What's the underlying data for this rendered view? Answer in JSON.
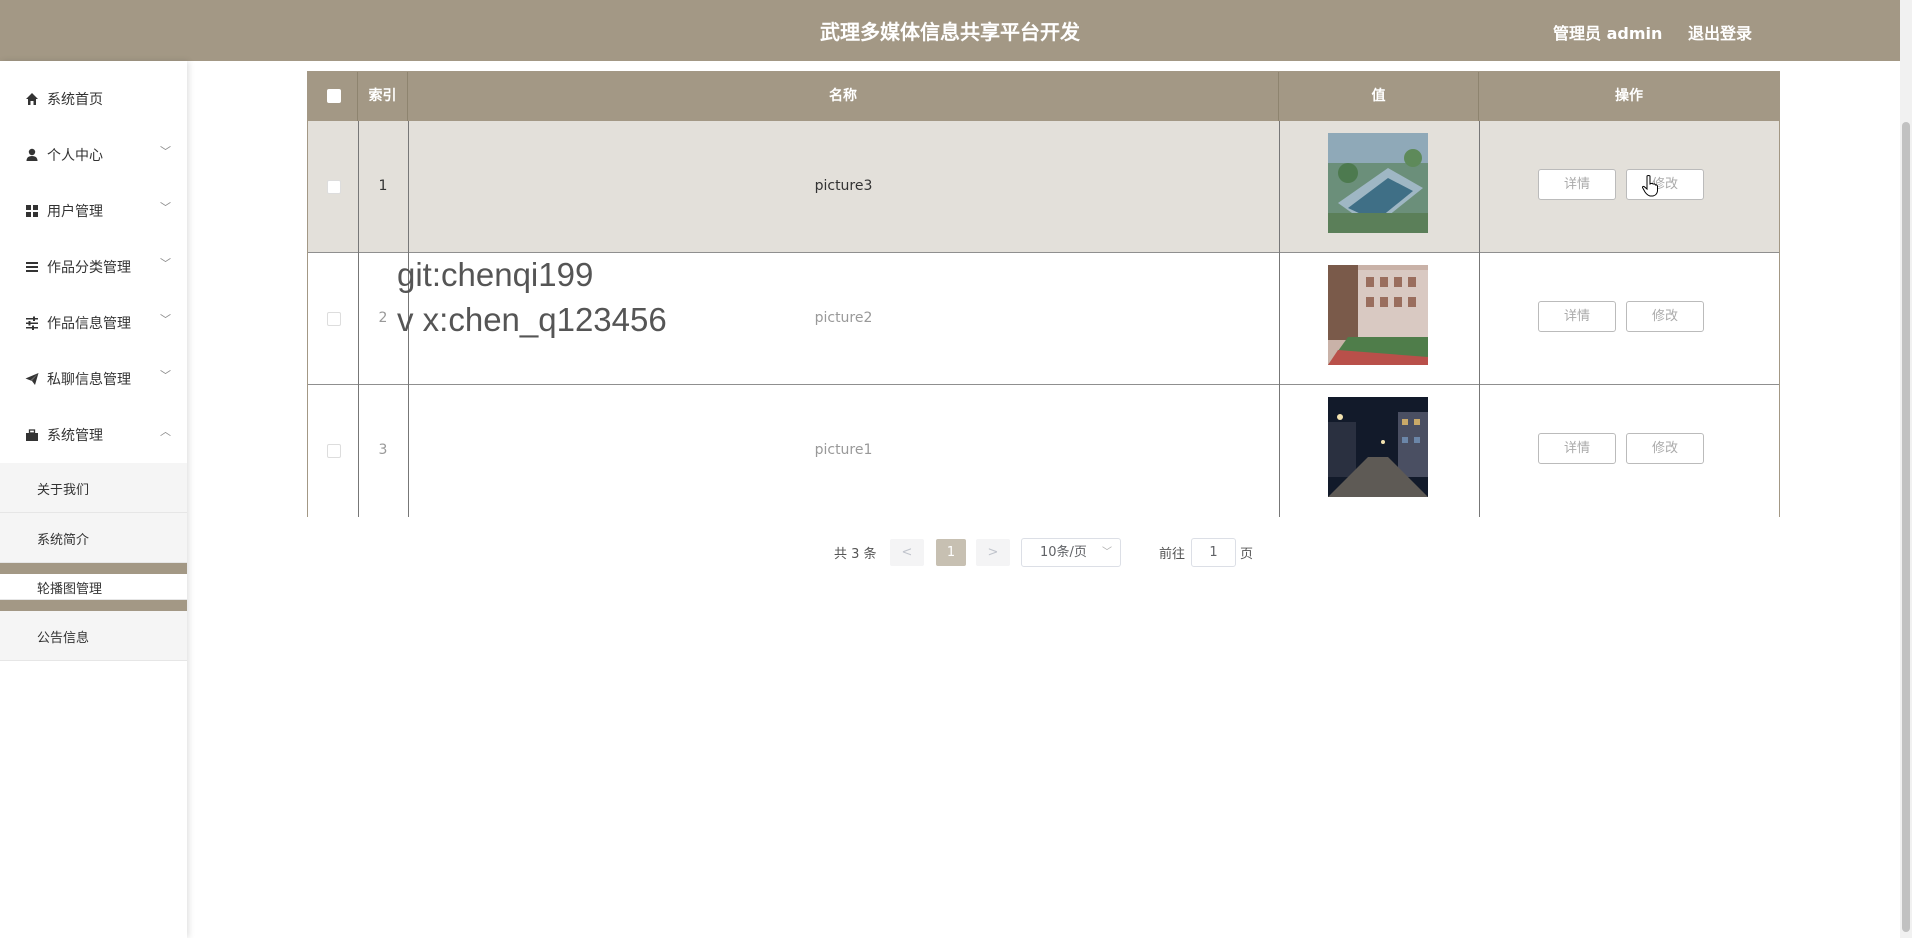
{
  "header": {
    "title": "武理多媒体信息共享平台开发",
    "admin_label": "管理员 admin",
    "logout_label": "退出登录"
  },
  "sidebar": {
    "items": [
      {
        "label": "系统首页",
        "icon": "home-icon"
      },
      {
        "label": "个人中心",
        "icon": "user-icon"
      },
      {
        "label": "用户管理",
        "icon": "grid-icon"
      },
      {
        "label": "作品分类管理",
        "icon": "list-icon"
      },
      {
        "label": "作品信息管理",
        "icon": "sliders-icon"
      },
      {
        "label": "私聊信息管理",
        "icon": "send-icon"
      },
      {
        "label": "系统管理",
        "icon": "briefcase-icon"
      }
    ],
    "sub_items": [
      {
        "label": "关于我们"
      },
      {
        "label": "系统简介"
      },
      {
        "label": "轮播图管理"
      },
      {
        "label": "公告信息"
      }
    ]
  },
  "table": {
    "headers": {
      "index": "索引",
      "name": "名称",
      "value": "值",
      "action": "操作"
    },
    "rows": [
      {
        "index": "1",
        "name": "picture3",
        "image": "campus-aerial-thumbnail"
      },
      {
        "index": "2",
        "name": "picture2",
        "image": "campus-building-thumbnail"
      },
      {
        "index": "3",
        "name": "picture1",
        "image": "campus-night-thumbnail"
      }
    ],
    "detail_label": "详情",
    "edit_label": "修改"
  },
  "watermark": {
    "line1": "git:chenqi199",
    "line2": "v x:chen_q123456"
  },
  "pagination": {
    "total": "共 3 条",
    "prev": "<",
    "current": "1",
    "next": ">",
    "page_size": "10条/页",
    "goto": "前往",
    "goto_value": "1",
    "page": "页"
  },
  "colors": {
    "accent": "#a39885",
    "row_hover": "#e3e0da"
  }
}
